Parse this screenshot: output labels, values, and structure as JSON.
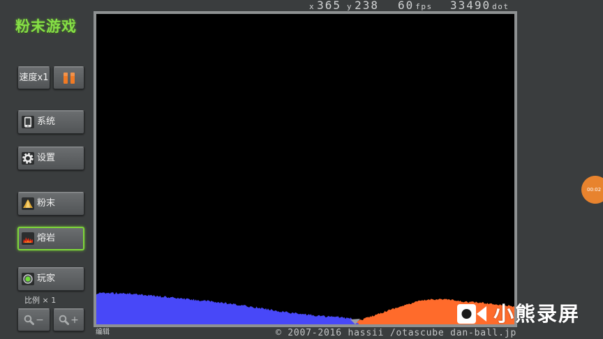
{
  "app": {
    "title": "粉末游戏"
  },
  "status": {
    "cursor_x_label": "x",
    "cursor_x": "365",
    "cursor_y_label": "y",
    "cursor_y": "238",
    "fps": "60",
    "fps_unit": "fps",
    "dots": "33490",
    "dots_unit": "dot"
  },
  "controls": {
    "speed_label": "速度x1",
    "pause_icon": "pause-icon",
    "pause_color": "#f07a24"
  },
  "menu": [
    {
      "label": "系统",
      "icon": "tablet-icon"
    },
    {
      "label": "设置",
      "icon": "gear-icon"
    },
    {
      "label": "粉末",
      "icon": "powder-icon"
    },
    {
      "label": "熔岩",
      "icon": "lava-icon",
      "selected": true
    },
    {
      "label": "玩家",
      "icon": "player-icon"
    }
  ],
  "zoom": {
    "scale_label": "比例 × 1",
    "zoom_out_icon": "zoom-out-icon",
    "zoom_out_sign": "−",
    "zoom_in_icon": "zoom-in-icon",
    "zoom_in_sign": "+"
  },
  "canvas": {
    "background": "#000000",
    "frame": "#8e9192",
    "particle_colors": [
      "#4848f8",
      "#ff6b2b",
      "#9fa0a8"
    ]
  },
  "footer": {
    "mode": "编辑",
    "copyright": "© 2007-2016 hassii /otascube dan-ball.jp"
  },
  "overlay": {
    "recorder_icon": "video-camera-icon",
    "recorder_label": "小熊录屏",
    "timer": "00:02",
    "timer_color": "#e8832e"
  },
  "theme": {
    "background": "#3a3d3e",
    "title_green": "#86e046",
    "selected_border": "#7ed63a",
    "button_text": "#f2f2f2"
  }
}
